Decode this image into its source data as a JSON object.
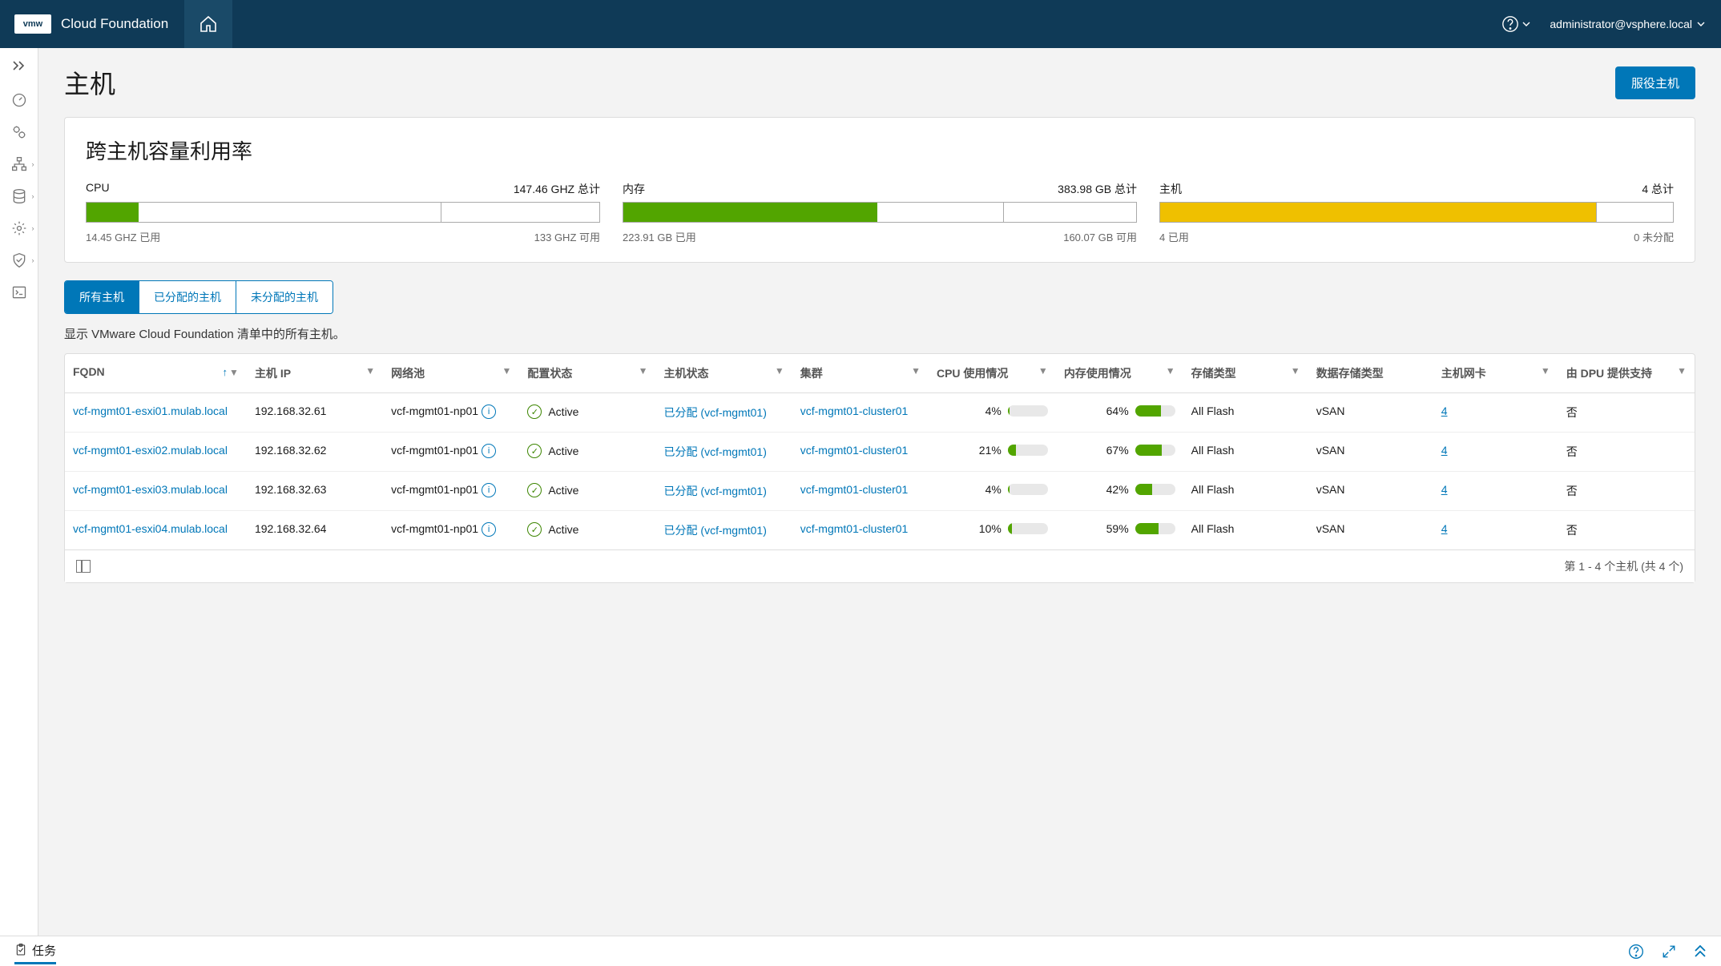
{
  "header": {
    "logo_text": "vmw",
    "product_title": "Cloud Foundation",
    "user": "administrator@vsphere.local"
  },
  "page": {
    "title": "主机",
    "commission_button": "服役主机"
  },
  "capacity": {
    "title": "跨主机容量利用率",
    "cpu": {
      "label": "CPU",
      "total": "147.46 GHZ 总计",
      "used": "14.45 GHZ 已用",
      "available": "133 GHZ 可用",
      "fill_percent": 10.1,
      "div_percent": 69
    },
    "memory": {
      "label": "内存",
      "total": "383.98 GB 总计",
      "used": "223.91 GB 已用",
      "available": "160.07 GB 可用",
      "fill_percent": 49.5,
      "div_percent": 74
    },
    "hosts": {
      "label": "主机",
      "total": "4 总计",
      "used": "4 已用",
      "available": "0 未分配",
      "fill_percent": 85,
      "div_percent": 85
    }
  },
  "tabs": {
    "all": "所有主机",
    "assigned": "已分配的主机",
    "unassigned": "未分配的主机",
    "description": "显示 VMware Cloud Foundation 清单中的所有主机。"
  },
  "table": {
    "columns": {
      "fqdn": "FQDN",
      "host_ip": "主机 IP",
      "network_pool": "网络池",
      "config_status": "配置状态",
      "host_state": "主机状态",
      "cluster": "集群",
      "cpu_usage": "CPU 使用情况",
      "memory_usage": "内存使用情况",
      "storage_type": "存储类型",
      "datastore_type": "数据存储类型",
      "host_nics": "主机网卡",
      "dpu_backed": "由 DPU 提供支持"
    },
    "rows": [
      {
        "fqdn": "vcf-mgmt01-esxi01.mulab.local",
        "host_ip": "192.168.32.61",
        "network_pool": "vcf-mgmt01-np01",
        "config_status": "Active",
        "host_state": "已分配 (vcf-mgmt01)",
        "cluster": "vcf-mgmt01-cluster01",
        "cpu_pct": "4%",
        "cpu_fill": 4,
        "mem_pct": "64%",
        "mem_fill": 64,
        "storage_type": "All Flash",
        "datastore_type": "vSAN",
        "nics": "4",
        "dpu": "否"
      },
      {
        "fqdn": "vcf-mgmt01-esxi02.mulab.local",
        "host_ip": "192.168.32.62",
        "network_pool": "vcf-mgmt01-np01",
        "config_status": "Active",
        "host_state": "已分配 (vcf-mgmt01)",
        "cluster": "vcf-mgmt01-cluster01",
        "cpu_pct": "21%",
        "cpu_fill": 21,
        "mem_pct": "67%",
        "mem_fill": 67,
        "storage_type": "All Flash",
        "datastore_type": "vSAN",
        "nics": "4",
        "dpu": "否"
      },
      {
        "fqdn": "vcf-mgmt01-esxi03.mulab.local",
        "host_ip": "192.168.32.63",
        "network_pool": "vcf-mgmt01-np01",
        "config_status": "Active",
        "host_state": "已分配 (vcf-mgmt01)",
        "cluster": "vcf-mgmt01-cluster01",
        "cpu_pct": "4%",
        "cpu_fill": 4,
        "mem_pct": "42%",
        "mem_fill": 42,
        "storage_type": "All Flash",
        "datastore_type": "vSAN",
        "nics": "4",
        "dpu": "否"
      },
      {
        "fqdn": "vcf-mgmt01-esxi04.mulab.local",
        "host_ip": "192.168.32.64",
        "network_pool": "vcf-mgmt01-np01",
        "config_status": "Active",
        "host_state": "已分配 (vcf-mgmt01)",
        "cluster": "vcf-mgmt01-cluster01",
        "cpu_pct": "10%",
        "cpu_fill": 10,
        "mem_pct": "59%",
        "mem_fill": 59,
        "storage_type": "All Flash",
        "datastore_type": "vSAN",
        "nics": "4",
        "dpu": "否"
      }
    ],
    "footer": "第 1 - 4 个主机 (共 4 个)"
  },
  "bottom": {
    "tasks_label": "任务"
  }
}
